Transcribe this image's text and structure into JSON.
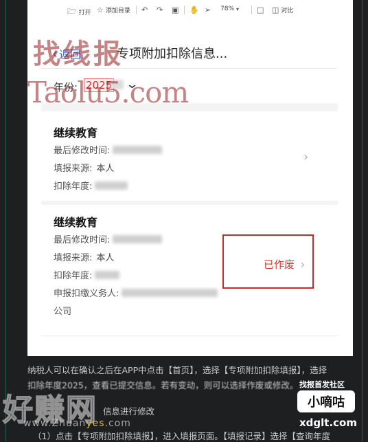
{
  "toolbar": {
    "open": "打开",
    "add_bookmark": "添加目录",
    "zoom": "78%",
    "compare": "对比"
  },
  "watermark": {
    "top_cn": "找线报",
    "top_en": "Taolu5.com",
    "bottom_cn": "好赚网",
    "bottom_url_a": "www.Zhuan",
    "bottom_url_b": "yes",
    "bottom_url_c": ".com"
  },
  "phone": {
    "back": "返回",
    "title": "专项附加扣除信息...",
    "year_label": "年份:",
    "year_value": "2025",
    "cards": [
      {
        "title": "继续教育",
        "modified_label": "最后修改时间:",
        "source_label": "填报来源:",
        "source_value": "本人",
        "year_label": "扣除年度:"
      },
      {
        "title": "继续教育",
        "modified_label": "最后修改时间:",
        "source_label": "填报来源:",
        "source_value": "本人",
        "year_label": "扣除年度:",
        "agent_label": "申报扣缴义务人:",
        "agent_tail": "公司",
        "status": "已作废"
      }
    ]
  },
  "article": {
    "line1": "纳税人可以在确认之后在APP中点击【首页】，选择【专项附加扣除填报】，选择",
    "line2": "扣除年度2025，查看已提交信息。若有变动，则可以选择作废或修改。",
    "line3": "信息进行修改",
    "line4": "（1）点击【专项附加扣除填报】，进入填报页面。【填报记录】选择【查询年度"
  },
  "brand": {
    "subtitle": "找报首发社区",
    "name": "小嘀咕",
    "url": "xdglt.com"
  },
  "colors": {
    "accent_blue": "#3a6fd8",
    "void_red": "#cc2a2a",
    "year_red": "#d8262c"
  }
}
